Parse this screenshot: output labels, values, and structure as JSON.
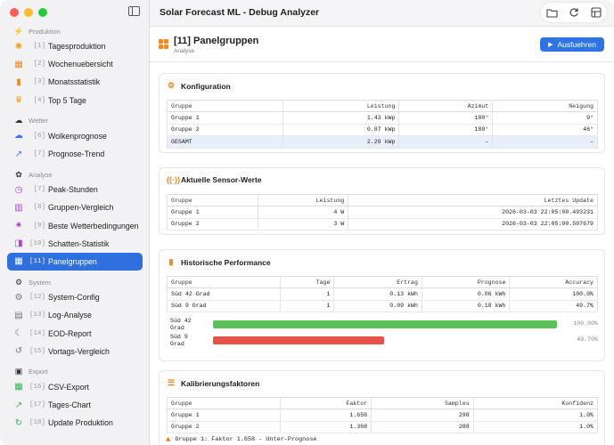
{
  "app": {
    "title": "Solar Forecast ML - Debug Analyzer"
  },
  "sidebar": {
    "sections": [
      {
        "label": "Produktion",
        "icon": "bolt-icon",
        "items": [
          {
            "num": "[1]",
            "label": "Tagesproduktion",
            "icon": "sun-icon",
            "color": "#f0a020"
          },
          {
            "num": "[2]",
            "label": "Wochenuebersicht",
            "icon": "calendar-icon",
            "color": "#f08a24"
          },
          {
            "num": "[3]",
            "label": "Monatsstatistik",
            "icon": "bar-chart-icon",
            "color": "#f08a24"
          },
          {
            "num": "[4]",
            "label": "Top 5 Tage",
            "icon": "trophy-icon",
            "color": "#f0a020"
          }
        ]
      },
      {
        "label": "Wetter",
        "icon": "cloud-sun-icon",
        "items": [
          {
            "num": "[6]",
            "label": "Wolkenprognose",
            "icon": "cloud-icon",
            "color": "#3478f6"
          },
          {
            "num": "[7]",
            "label": "Prognose-Trend",
            "icon": "trend-arrow-icon",
            "color": "#3478f6"
          }
        ]
      },
      {
        "label": "Analyse",
        "icon": "brain-icon",
        "items": [
          {
            "num": "[7]",
            "label": "Peak-Stunden",
            "icon": "clock-icon",
            "color": "#b040d0"
          },
          {
            "num": "[8]",
            "label": "Gruppen-Vergleich",
            "icon": "columns-icon",
            "color": "#b040d0"
          },
          {
            "num": "[9]",
            "label": "Beste Wetterbedingungen",
            "icon": "sparkle-icon",
            "color": "#b040d0"
          },
          {
            "num": "[10]",
            "label": "Schatten-Statistik",
            "icon": "shade-icon",
            "color": "#b040d0"
          },
          {
            "num": "[11]",
            "label": "Panelgruppen",
            "icon": "panels-icon",
            "color": "#ffffff",
            "active": true
          }
        ]
      },
      {
        "label": "System",
        "icon": "gear-icon",
        "items": [
          {
            "num": "[12]",
            "label": "System-Config",
            "icon": "gear-icon",
            "color": "#777777"
          },
          {
            "num": "[13]",
            "label": "Log-Analyse",
            "icon": "document-search-icon",
            "color": "#777777"
          },
          {
            "num": "[14]",
            "label": "EOD-Report",
            "icon": "moon-icon",
            "color": "#777777"
          },
          {
            "num": "[15]",
            "label": "Vortags-Vergleich",
            "icon": "history-icon",
            "color": "#777777"
          }
        ]
      },
      {
        "label": "Export",
        "icon": "shopping-bag-icon",
        "items": [
          {
            "num": "[16]",
            "label": "CSV-Export",
            "icon": "table-icon",
            "color": "#2fb34a"
          },
          {
            "num": "[17]",
            "label": "Tages-Chart",
            "icon": "line-chart-icon",
            "color": "#2fb34a"
          },
          {
            "num": "[18]",
            "label": "Update Produktion",
            "icon": "refresh-icon",
            "color": "#2fb34a"
          }
        ]
      }
    ]
  },
  "header": {
    "title": "[11] Panelgruppen",
    "subtitle": "Analyse",
    "run_label": "Ausfuehren"
  },
  "konfiguration": {
    "title": "Konfiguration",
    "columns": [
      "Gruppe",
      "Leistung",
      "Azimut",
      "Neigung"
    ],
    "rows": [
      [
        "Gruppe 1",
        "1.43 kWp",
        "180°",
        "9°"
      ],
      [
        "Gruppe 2",
        "0.87 kWp",
        "180°",
        "46°"
      ],
      [
        "GESAMT",
        "2.29 kWp",
        "–",
        "–"
      ]
    ]
  },
  "sensor": {
    "title": "Aktuelle Sensor-Werte",
    "columns": [
      "Gruppe",
      "Leistung",
      "Letztes Update"
    ],
    "rows": [
      [
        "Gruppe 1",
        "4 W",
        "2026-03-03 22:05:00.493231"
      ],
      [
        "Gruppe 2",
        "3 W",
        "2026-03-03 22:05:00.507679"
      ]
    ]
  },
  "performance": {
    "title": "Historische Performance",
    "columns": [
      "Gruppe",
      "Tage",
      "Ertrag",
      "Prognose",
      "Accuracy"
    ],
    "rows": [
      [
        "Süd 42 Grad",
        "1",
        "0.13 kWh",
        "0.06 kWh",
        "100.0%"
      ],
      [
        "Süd 9 Grad",
        "1",
        "0.09 kWh",
        "0.18 kWh",
        "49.7%"
      ]
    ],
    "bars": [
      {
        "label": "Süd 42\nGrad",
        "value_label": "100.00%",
        "fraction": 1.0,
        "color": "#5cc05a"
      },
      {
        "label": "Süd 9\nGrad",
        "value_label": "49.70%",
        "fraction": 0.497,
        "color": "#e8504a"
      }
    ]
  },
  "kalibrierung": {
    "title": "Kalibrierungsfaktoren",
    "columns": [
      "Gruppe",
      "Faktor",
      "Samples",
      "Konfidenz"
    ],
    "rows": [
      [
        "Gruppe 1",
        "1.658",
        "298",
        "1.0%"
      ],
      [
        "Gruppe 2",
        "1.368",
        "288",
        "1.0%"
      ]
    ],
    "warning": "Gruppe 1: Faktor 1.658 - Unter-Prognose"
  }
}
